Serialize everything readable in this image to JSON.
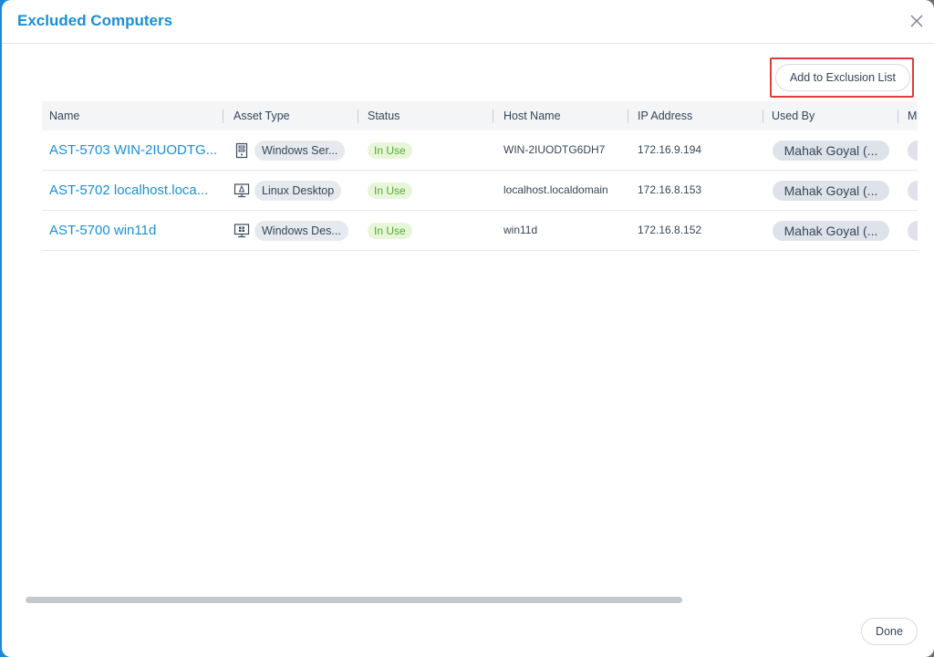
{
  "modal": {
    "title": "Excluded Computers",
    "add_button_label": "Add to Exclusion List",
    "done_button_label": "Done"
  },
  "table": {
    "columns": [
      "Name",
      "Asset Type",
      "Status",
      "Host Name",
      "IP Address",
      "Used By",
      "M"
    ],
    "rows": [
      {
        "name": "AST-5703 WIN-2IUODTG...",
        "asset_icon": "server-icon",
        "asset_type": "Windows Ser...",
        "status": "In Use",
        "host_name": "WIN-2IUODTG6DH7",
        "ip_address": "172.16.9.194",
        "used_by": "Mahak Goyal (..."
      },
      {
        "name": "AST-5702 localhost.loca...",
        "asset_icon": "linux-desktop-icon",
        "asset_type": "Linux Desktop",
        "status": "In Use",
        "host_name": "localhost.localdomain",
        "ip_address": "172.16.8.153",
        "used_by": "Mahak Goyal (..."
      },
      {
        "name": "AST-5700 win11d",
        "asset_icon": "windows-desktop-icon",
        "asset_type": "Windows Des...",
        "status": "In Use",
        "host_name": "win11d",
        "ip_address": "172.16.8.152",
        "used_by": "Mahak Goyal (..."
      }
    ]
  },
  "colors": {
    "accent": "#1a8fd6",
    "status_in_use_bg": "#e7f6d8",
    "status_in_use_text": "#5aa83a",
    "highlight_frame": "#e03b3b"
  }
}
